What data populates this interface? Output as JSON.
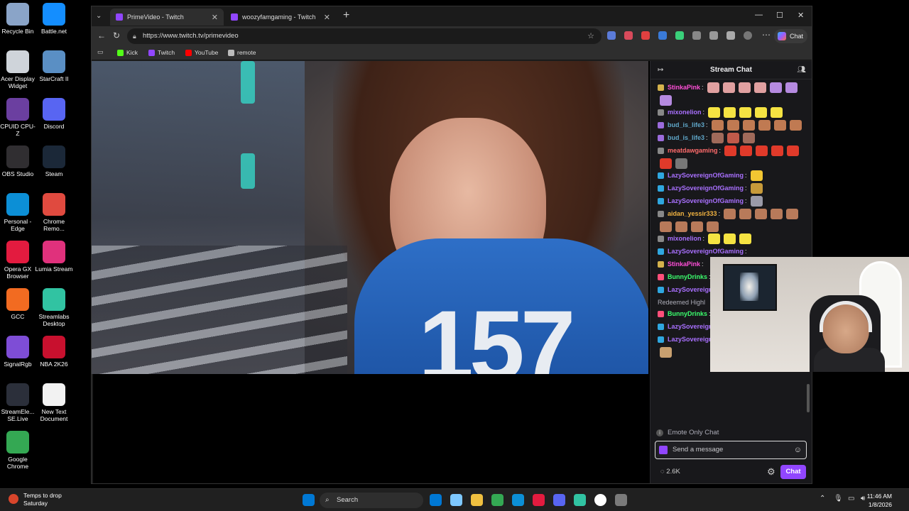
{
  "desktop_icons": [
    {
      "label": "Recycle Bin",
      "color": "#8aa4c8"
    },
    {
      "label": "Battle.net",
      "color": "#148eff"
    },
    {
      "label": "Acer Display Widget",
      "color": "#cfd4da"
    },
    {
      "label": "StarCraft II",
      "color": "#5a8fc4"
    },
    {
      "label": "CPUID CPU-Z",
      "color": "#6b3fa0"
    },
    {
      "label": "Discord",
      "color": "#5865f2"
    },
    {
      "label": "OBS Studio",
      "color": "#302e31"
    },
    {
      "label": "Steam",
      "color": "#1b2838"
    },
    {
      "label": "Personal - Edge",
      "color": "#0c8fd6"
    },
    {
      "label": "Chrome Remo...",
      "color": "#e04a3f"
    },
    {
      "label": "Opera GX Browser",
      "color": "#e31b3f"
    },
    {
      "label": "Lumia Stream",
      "color": "#e0317c"
    },
    {
      "label": "GCC",
      "color": "#f26b21"
    },
    {
      "label": "Streamlabs Desktop",
      "color": "#31c3a2"
    },
    {
      "label": "SignalRgb",
      "color": "#7e4dd6"
    },
    {
      "label": "NBA 2K26",
      "color": "#c8102e"
    },
    {
      "label": "StreamEle... SE.Live",
      "color": "#2b2f3a"
    },
    {
      "label": "New Text Document",
      "color": "#f2f2f2"
    },
    {
      "label": "Google Chrome",
      "color": "#34a853"
    }
  ],
  "browser": {
    "tabs": [
      {
        "label": "PrimeVideo - Twitch",
        "close": "✕"
      },
      {
        "label": "woozyfamgaming - Twitch",
        "close": "✕"
      }
    ],
    "new_tab": "+",
    "url": "https://www.twitch.tv/primevideo",
    "chat_button": "Chat",
    "bookmarks": [
      {
        "label": "Kick",
        "color": "#53fc18"
      },
      {
        "label": "Twitch",
        "color": "#9146ff"
      },
      {
        "label": "YouTube",
        "color": "#ff0000"
      },
      {
        "label": "remote",
        "color": "#bbbbbb"
      }
    ],
    "window_controls": {
      "minimize": "—",
      "maximize": "☐",
      "close": "✕"
    }
  },
  "video": {
    "jersey_number": "157"
  },
  "chat": {
    "title": "Stream Chat",
    "messages": [
      {
        "user": "StinkaPink",
        "color": "#ff4fd8",
        "badge": "#d4b24c",
        "emotes": [
          "#e0a0a0",
          "#e0a0a0",
          "#e0a0a0",
          "#e0a0a0",
          "#b58ae0",
          "#b58ae0",
          "#b58ae0"
        ]
      },
      {
        "user": "mixonelion",
        "color": "#a970ff",
        "badge": "#888888",
        "emotes": [
          "#f5e342",
          "#f5e342",
          "#f5e342",
          "#f5e342",
          "#f5e342"
        ]
      },
      {
        "user": "bud_is_life3",
        "color": "#5fa6c8",
        "badge": "#9b6bdc",
        "emotes": [
          "#c07a52",
          "#c07a52",
          "#c07a52",
          "#c07a52",
          "#c07a52",
          "#c07a52"
        ]
      },
      {
        "user": "bud_is_life3",
        "color": "#5fa6c8",
        "badge": "#9b6bdc",
        "emotes": [
          "#a06a5a",
          "#c05a4a",
          "#a06a5a"
        ]
      },
      {
        "user": "meatdawgaming",
        "color": "#ff6b6b",
        "badge": "#888888",
        "emotes": [
          "#e03a2a",
          "#e03a2a",
          "#e03a2a",
          "#e03a2a",
          "#e03a2a",
          "#e03a2a",
          "#777777"
        ]
      },
      {
        "user": "LazySovereignOfGaming",
        "color": "#a970ff",
        "badge": "#2fa7e0",
        "emotes": [
          "#f2c632"
        ]
      },
      {
        "user": "LazySovereignOfGaming",
        "color": "#a970ff",
        "badge": "#2fa7e0",
        "emotes": [
          "#c79a3a"
        ]
      },
      {
        "user": "LazySovereignOfGaming",
        "color": "#a970ff",
        "badge": "#2fa7e0",
        "emotes": [
          "#9a9aa8"
        ]
      },
      {
        "user": "aidan_yessir333",
        "color": "#f0b240",
        "badge": "#888888",
        "emotes": [
          "#b87a5a",
          "#b87a5a",
          "#b87a5a",
          "#b87a5a",
          "#b87a5a",
          "#b87a5a",
          "#b87a5a",
          "#b87a5a",
          "#b87a5a"
        ]
      },
      {
        "user": "mixonelion",
        "color": "#a970ff",
        "badge": "#888888",
        "emotes": [
          "#f5e342",
          "#f5e342",
          "#f5e342"
        ]
      },
      {
        "user": "LazySovereignOfGaming",
        "color": "#a970ff",
        "badge": "#2fa7e0",
        "emotes": []
      },
      {
        "user": "StinkaPink",
        "color": "#ff4fd8",
        "badge": "#d4b24c",
        "emotes": []
      },
      {
        "user": "BunnyDrinks",
        "color": "#3cff6e",
        "badge": "#ff4f7a",
        "emotes": [
          "#f2c0d8",
          "#f2c0d8",
          "#f2c0d8",
          "#f2c0d8"
        ]
      },
      {
        "user": "LazySovereignOfGaming",
        "color": "#a970ff",
        "badge": "#2fa7e0",
        "emotes": []
      }
    ],
    "highlight_label": "Redeemed Highl",
    "highlight_messages": [
      {
        "user": "BunnyDrinks",
        "color": "#3cff6e",
        "badge": "#ff4f7a",
        "emotes": [
          "#f2c0d8",
          "#f2c0d8",
          "#f2c0d8",
          "#f2c0d8",
          "#f2c0d8",
          "#f2c0d8"
        ]
      }
    ],
    "bottom_messages": [
      {
        "user": "LazySovereignOfGaming",
        "color": "#a970ff",
        "badge": "#2fa7e0",
        "emotes": [
          "#c8504a",
          "#e07a2a"
        ]
      },
      {
        "user": "LazySovereignOfGaming",
        "color": "#a970ff",
        "badge": "#2fa7e0",
        "emotes": [
          "#6a9ac8",
          "#c05050",
          "#6aa0c8",
          "#c8a070"
        ]
      }
    ],
    "emote_only": "Emote Only Chat",
    "placeholder": "Send a message",
    "viewers": "2.6K",
    "send_label": "Chat"
  },
  "taskbar": {
    "weather_title": "Temps to drop",
    "weather_sub": "Saturday",
    "search": "Search",
    "time": "11:46 AM",
    "date": "1/8/2026",
    "apps": [
      "#0078d4",
      "#7ec8ff",
      "#f0c040",
      "#34a853",
      "#0c8fd6",
      "#e31b3f",
      "#5865f2",
      "#31c3a2",
      "#ffffff",
      "#7a7a7a"
    ]
  },
  "colors": {
    "twitch_purple": "#9146ff",
    "chat_bg": "#18181b"
  }
}
